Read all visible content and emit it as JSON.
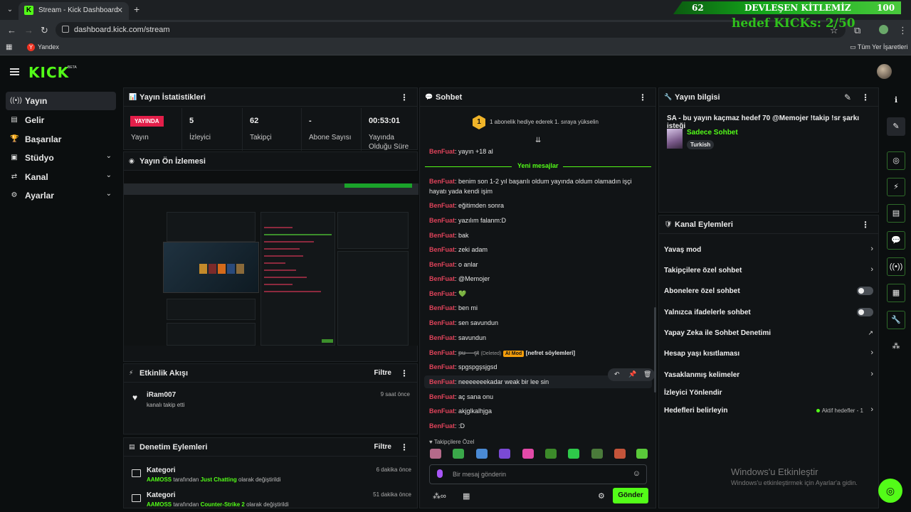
{
  "browser": {
    "tab_title": "Stream - Kick Dashboard",
    "url": "dashboard.kick.com/stream",
    "bookmark_yandex": "Yandex",
    "bookmark_all": "Tüm Yer İşaretleri"
  },
  "overlay": {
    "count": "62",
    "title": "DEVLEŞEN KİTLEMİZ",
    "max": "100",
    "subtitle": "hedef KICKs: 2/50"
  },
  "header": {
    "logo": "KICK",
    "beta": "BETA"
  },
  "sidebar": {
    "items": [
      {
        "label": "Yayın",
        "icon": "broadcast-icon"
      },
      {
        "label": "Gelir",
        "icon": "wallet-icon"
      },
      {
        "label": "Başarılar",
        "icon": "trophy-icon"
      },
      {
        "label": "Stüdyo",
        "icon": "studio-icon"
      },
      {
        "label": "Kanal",
        "icon": "channel-icon"
      },
      {
        "label": "Ayarlar",
        "icon": "gear-icon"
      }
    ]
  },
  "stats": {
    "title": "Yayın İstatistikleri",
    "live_badge": "YAYINDA",
    "live_label": "Yayın",
    "viewers_value": "5",
    "viewers_label": "İzleyici",
    "followers_value": "62",
    "followers_label": "Takipçi",
    "subs_value": "-",
    "subs_label": "Abone Sayısı",
    "uptime_value": "00:53:01",
    "uptime_label": "Yayında Olduğu Süre"
  },
  "preview": {
    "title": "Yayın Ön İzlemesi"
  },
  "activity": {
    "title": "Etkinlik Akışı",
    "filter": "Filtre",
    "item_name": "iRam007",
    "item_desc": "kanalı takip etti",
    "item_time": "9 saat önce"
  },
  "moderation": {
    "title": "Denetim Eylemleri",
    "filter": "Filtre",
    "rows": [
      {
        "title": "Kategori",
        "user": "AAMOSS",
        "mid": " tarafından ",
        "target": "Just Chatting",
        "end": " olarak değiştirildi",
        "time": "6 dakika önce"
      },
      {
        "title": "Kategori",
        "user": "AAMOSS",
        "mid": " tarafından ",
        "target": "Counter-Strike 2",
        "end": " olarak değiştirildi",
        "time": "51 dakika önce"
      }
    ]
  },
  "chat": {
    "title": "Sohbet",
    "gift_rank": "1",
    "gift_text": "1 abonelik hediye ederek 1. sıraya yükselin",
    "new_messages": "Yeni mesajlar",
    "messages": [
      {
        "user": "BenFuat",
        "text": "yayın +18 al"
      },
      {
        "user": "BenFuat",
        "text": "benim son 1-2 yıl başarılı oldum yayında oldum olamadın işçi hayatı yada kendi işim"
      },
      {
        "user": "BenFuat",
        "text": "eğitimden sonra"
      },
      {
        "user": "BenFuat",
        "text": "yazılım falanm:D"
      },
      {
        "user": "BenFuat",
        "text": "bak"
      },
      {
        "user": "BenFuat",
        "text": "zeki adam"
      },
      {
        "user": "BenFuat",
        "text": "o anlar"
      },
      {
        "user": "BenFuat",
        "text": "@Memojer"
      },
      {
        "user": "BenFuat",
        "text": "💚"
      },
      {
        "user": "BenFuat",
        "text": "ben mi"
      },
      {
        "user": "BenFuat",
        "text": "sen savundun"
      },
      {
        "user": "BenFuat",
        "text": "savundun"
      },
      {
        "user": "BenFuat",
        "text": "spgspgşsjgsd"
      },
      {
        "user": "BenFuat",
        "text": "neeeeeeekadar weak bir lee sin"
      },
      {
        "user": "BenFuat",
        "text": "aç sana onu"
      },
      {
        "user": "BenFuat",
        "text": "akjglkalhjga"
      },
      {
        "user": "BenFuat",
        "text": ":D"
      }
    ],
    "deleted": {
      "user": "BenFuat",
      "text": "pu----şt",
      "tag": "(Deleted)",
      "badge": "AI Mod",
      "reason": "[nefret söylemleri]"
    },
    "emote_label": "Takipçilere Özel",
    "input_placeholder": "Bir mesaj gönderin",
    "send": "Gönder"
  },
  "stream_info": {
    "title": "Yayın bilgisi",
    "stream_title": "SA - bu yayın kaçmaz hedef 70 @Memojer !takip !sr şarkı isteği",
    "category": "Sadece Sohbet",
    "language": "Turkish"
  },
  "channel_actions": {
    "title": "Kanal Eylemleri",
    "items": [
      {
        "label": "Yavaş mod"
      },
      {
        "label": "Takipçilere özel sohbet"
      },
      {
        "label": "Abonelere özel sohbet"
      },
      {
        "label": "Yalnızca ifadelerle sohbet"
      },
      {
        "label": "Yapay Zeka ile Sohbet Denetimi"
      },
      {
        "label": "Hesap yaşı kısıtlaması"
      },
      {
        "label": "Yasaklanmış kelimeler"
      },
      {
        "label": "İzleyici Yönlendir"
      },
      {
        "label": "Hedefleri belirleyin"
      }
    ],
    "goals_status": "Aktif hedefler - 1"
  },
  "windows": {
    "activate_title": "Windows'u Etkinleştir",
    "activate_sub": "Windows'u etkinleştirmek için Ayarlar'a gidin."
  }
}
